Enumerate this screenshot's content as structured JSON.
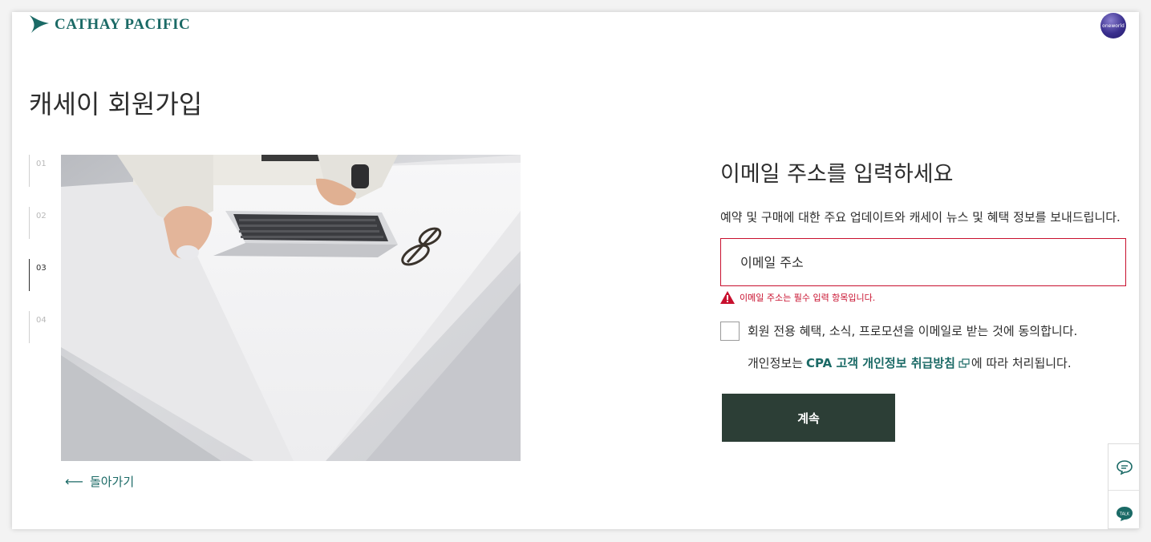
{
  "brand": {
    "name": "CATHAY PACIFIC",
    "alliance_badge": "oneworld",
    "brand_color": "#1b6a66"
  },
  "page": {
    "title": "캐세이 회원가입"
  },
  "steps": [
    {
      "label": "01",
      "active": false
    },
    {
      "label": "02",
      "active": false
    },
    {
      "label": "03",
      "active": true
    },
    {
      "label": "04",
      "active": false
    }
  ],
  "back": {
    "label": "돌아가기"
  },
  "form": {
    "title": "이메일 주소를 입력하세요",
    "subtitle": "예약 및 구매에 대한 주요 업데이트와 캐세이 뉴스 및 혜택 정보를 보내드립니다.",
    "email": {
      "placeholder": "이메일 주소",
      "value": "",
      "error": "이메일 주소는 필수 입력 항목입니다."
    },
    "consent": {
      "label": "회원 전용 혜택, 소식, 프로모션을 이메일로 받는 것에 동의합니다.",
      "checked": false
    },
    "privacy": {
      "prefix": "개인정보는",
      "link": "CPA 고객 개인정보 취급방침",
      "suffix": "에 따라 처리됩니다."
    },
    "continue_label": "계속"
  },
  "side_tools": [
    "chat-icon",
    "talk-icon"
  ],
  "colors": {
    "error": "#c8102e",
    "button": "#2c3e36",
    "link": "#1b6a66"
  }
}
